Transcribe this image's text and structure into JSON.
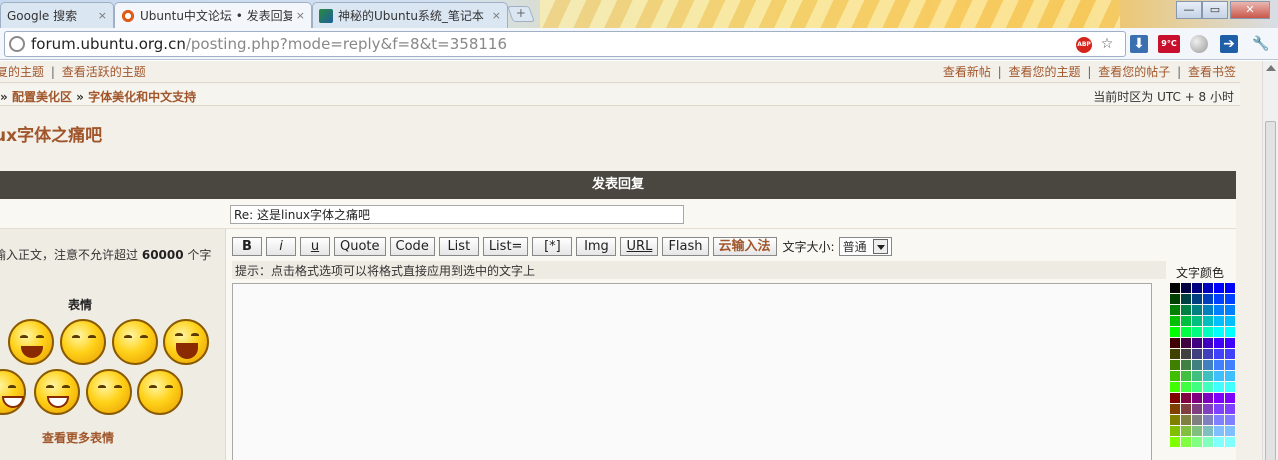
{
  "browser": {
    "tabs": [
      {
        "title": "Google 搜索",
        "icon": "google-icon",
        "active": false
      },
      {
        "title": "Ubuntu中文论坛 • 发表回复",
        "icon": "ubuntu-icon",
        "active": true
      },
      {
        "title": "神秘的Ubuntu系统_笔记本",
        "icon": "site-icon",
        "active": false
      }
    ],
    "tab_close": "×",
    "new_tab": "+",
    "window_controls": {
      "minimize": "—",
      "maximize": "▭",
      "close": "✕"
    },
    "url_host": "forum.ubuntu.org.cn",
    "url_path": "/posting.php?mode=reply&f=8&t=358116",
    "extensions": {
      "abp_label": "ABP",
      "weather_label": "9°C"
    }
  },
  "topnav": {
    "left_items": [
      "复的主题",
      "查看活跃的主题"
    ],
    "right_items": [
      "查看新帖",
      "查看您的主题",
      "查看您的帖子",
      "查看书签"
    ],
    "separator": "|"
  },
  "breadcrumb": {
    "items": [
      "配置美化区",
      "字体美化和中文支持"
    ],
    "arrow": "»",
    "timezone": "当前时区为 UTC + 8 小时"
  },
  "topic_title": "ux字体之痛吧",
  "post_form": {
    "header": "发表回复",
    "subject_value": "Re: 这是linux字体之痛吧",
    "message_hint_prefix": "输入正文，注意不允许超过",
    "message_hint_limit": "60000",
    "message_hint_suffix": "个字",
    "smilies_title": "表情",
    "more_smilies": "查看更多表情",
    "buttons": {
      "bold": "B",
      "italic": "i",
      "underline": "u",
      "quote": "Quote",
      "code": "Code",
      "list": "List",
      "list_ordered": "List=",
      "list_item": "[*]",
      "img": "Img",
      "url": "URL",
      "flash": "Flash",
      "ime": "云输入法"
    },
    "font_size_label": "文字大小:",
    "font_size_value": "普通",
    "tip": "提示：点击格式选项可以将格式直接应用到选中的文字上",
    "colors_title": "文字颜色"
  },
  "colors": {
    "accent": "#a0562a",
    "header_bg": "#4a4741",
    "page_bg": "#f3f0ea"
  }
}
